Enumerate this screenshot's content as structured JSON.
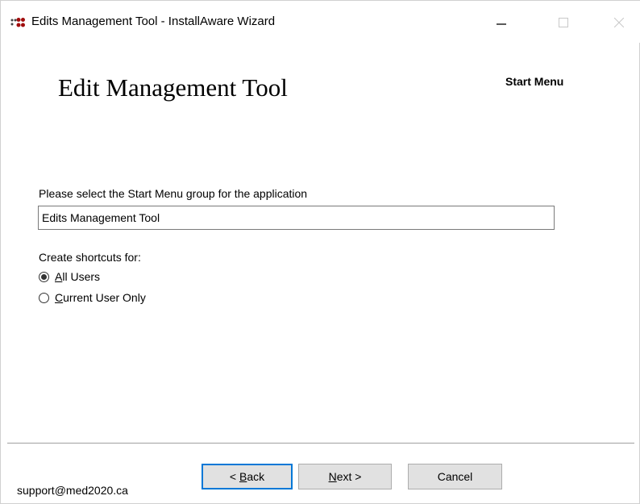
{
  "window": {
    "title": "Edits Management Tool - InstallAware Wizard",
    "icon": "installaware-dots-icon",
    "controls": [
      "minimize-icon",
      "maximize-icon",
      "close-icon"
    ]
  },
  "header": {
    "title": "Edit Management Tool",
    "page_name": "Start Menu"
  },
  "form": {
    "prompt": "Please select the Start Menu group for the application",
    "group_value": "Edits Management Tool",
    "shortcuts_label": "Create shortcuts for:",
    "options": [
      {
        "mnemonic": "A",
        "rest": "ll Users",
        "checked": true
      },
      {
        "mnemonic": "C",
        "rest": "urrent User Only",
        "checked": false
      }
    ]
  },
  "footer": {
    "support": "support@med2020.ca",
    "back": {
      "prefix": "< ",
      "mnemonic": "B",
      "rest": "ack"
    },
    "next": {
      "mnemonic": "N",
      "rest": "ext >"
    },
    "cancel": "Cancel"
  },
  "colors": {
    "icon_red": "#a00d0d",
    "icon_dark": "#444444",
    "focus_border": "#0078d7",
    "button_bg": "#e1e1e1"
  }
}
